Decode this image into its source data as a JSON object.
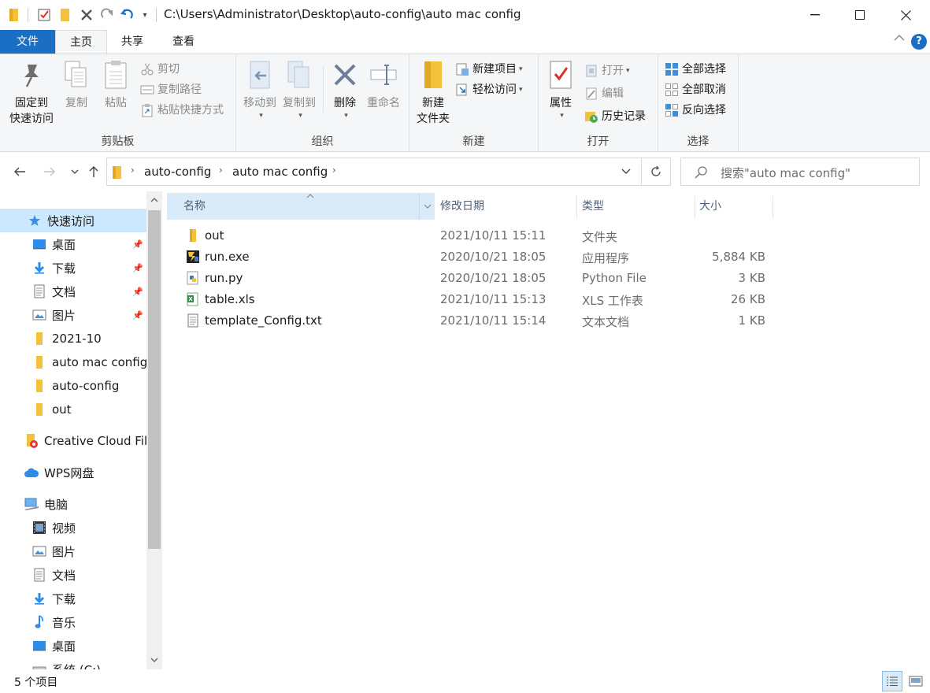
{
  "window": {
    "title": "C:\\Users\\Administrator\\Desktop\\auto-config\\auto mac config"
  },
  "tabs": {
    "file": "文件",
    "home": "主页",
    "share": "共享",
    "view": "查看"
  },
  "ribbon": {
    "clipboard": {
      "label": "剪贴板",
      "pin": "固定到",
      "pin2": "快速访问",
      "copy": "复制",
      "paste": "粘贴",
      "cut": "剪切",
      "copy_path": "复制路径",
      "paste_shortcut": "粘贴快捷方式"
    },
    "organize": {
      "label": "组织",
      "move_to": "移动到",
      "copy_to": "复制到",
      "delete": "删除",
      "rename": "重命名"
    },
    "new": {
      "label": "新建",
      "new_folder": "新建",
      "new_folder2": "文件夹",
      "new_item": "新建项目",
      "easy_access": "轻松访问"
    },
    "open": {
      "label": "打开",
      "properties": "属性",
      "open": "打开",
      "edit": "编辑",
      "history": "历史记录"
    },
    "select": {
      "label": "选择",
      "select_all": "全部选择",
      "select_none": "全部取消",
      "invert": "反向选择"
    }
  },
  "address": {
    "crumbs": [
      "auto-config",
      "auto mac config"
    ],
    "search_placeholder": "搜索\"auto mac config\""
  },
  "navpane": {
    "quick_access": "快速访问",
    "items": [
      {
        "label": "桌面",
        "pinned": true
      },
      {
        "label": "下载",
        "pinned": true
      },
      {
        "label": "文档",
        "pinned": true
      },
      {
        "label": "图片",
        "pinned": true
      },
      {
        "label": "2021-10",
        "pinned": false
      },
      {
        "label": "auto mac config",
        "pinned": false
      },
      {
        "label": "auto-config",
        "pinned": false
      },
      {
        "label": "out",
        "pinned": false
      }
    ],
    "creative_cloud": "Creative Cloud Files",
    "wps": "WPS网盘",
    "this_pc": "电脑",
    "pc_items": [
      "视频",
      "图片",
      "文档",
      "下载",
      "音乐",
      "桌面",
      "系统 (C:)"
    ]
  },
  "columns": {
    "name": "名称",
    "date": "修改日期",
    "type": "类型",
    "size": "大小"
  },
  "files": [
    {
      "name": "out",
      "date": "2021/10/11 15:11",
      "type": "文件夹",
      "size": "",
      "icon": "folder-icon"
    },
    {
      "name": "run.exe",
      "date": "2020/10/21 18:05",
      "type": "应用程序",
      "size": "5,884 KB",
      "icon": "exe-icon"
    },
    {
      "name": "run.py",
      "date": "2020/10/21 18:05",
      "type": "Python File",
      "size": "3 KB",
      "icon": "python-icon"
    },
    {
      "name": "table.xls",
      "date": "2021/10/11 15:13",
      "type": "XLS 工作表",
      "size": "26 KB",
      "icon": "excel-icon"
    },
    {
      "name": "template_Config.txt",
      "date": "2021/10/11 15:14",
      "type": "文本文档",
      "size": "1 KB",
      "icon": "text-file-icon"
    }
  ],
  "status": {
    "count": "5 个项目"
  },
  "colors": {
    "accent": "#1a6fc4",
    "selected": "#cce8ff",
    "folder": "#f3c13a"
  }
}
